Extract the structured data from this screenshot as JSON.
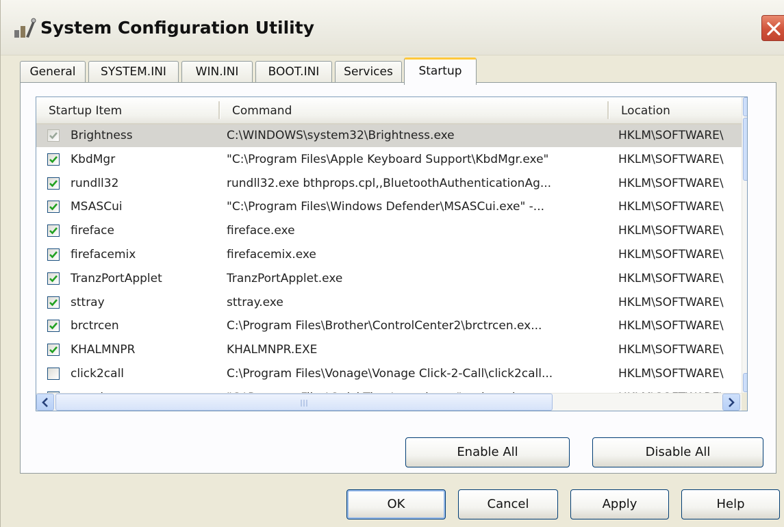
{
  "window": {
    "title": "System Configuration Utility"
  },
  "tabs": [
    {
      "label": "General"
    },
    {
      "label": "SYSTEM.INI"
    },
    {
      "label": "WIN.INI"
    },
    {
      "label": "BOOT.INI"
    },
    {
      "label": "Services"
    },
    {
      "label": "Startup"
    }
  ],
  "active_tab": "Startup",
  "list": {
    "columns": [
      "Startup Item",
      "Command",
      "Location"
    ],
    "rows": [
      {
        "item": "Brightness",
        "command": "C:\\WINDOWS\\system32\\Brightness.exe",
        "location": "HKLM\\SOFTWARE\\",
        "checked": true,
        "selected": true
      },
      {
        "item": "KbdMgr",
        "command": "\"C:\\Program Files\\Apple Keyboard Support\\KbdMgr.exe\"",
        "location": "HKLM\\SOFTWARE\\",
        "checked": true,
        "selected": false
      },
      {
        "item": "rundll32",
        "command": "rundll32.exe bthprops.cpl,,BluetoothAuthenticationAg...",
        "location": "HKLM\\SOFTWARE\\",
        "checked": true,
        "selected": false
      },
      {
        "item": "MSASCui",
        "command": "\"C:\\Program Files\\Windows Defender\\MSASCui.exe\" -...",
        "location": "HKLM\\SOFTWARE\\",
        "checked": true,
        "selected": false
      },
      {
        "item": "fireface",
        "command": "fireface.exe",
        "location": "HKLM\\SOFTWARE\\",
        "checked": true,
        "selected": false
      },
      {
        "item": "firefacemix",
        "command": "firefacemix.exe",
        "location": "HKLM\\SOFTWARE\\",
        "checked": true,
        "selected": false
      },
      {
        "item": "TranzPortApplet",
        "command": "TranzPortApplet.exe",
        "location": "HKLM\\SOFTWARE\\",
        "checked": true,
        "selected": false
      },
      {
        "item": "sttray",
        "command": "sttray.exe",
        "location": "HKLM\\SOFTWARE\\",
        "checked": true,
        "selected": false
      },
      {
        "item": "brctrcen",
        "command": "C:\\Program Files\\Brother\\ControlCenter2\\brctrcen.ex...",
        "location": "HKLM\\SOFTWARE\\",
        "checked": true,
        "selected": false
      },
      {
        "item": "KHALMNPR",
        "command": "KHALMNPR.EXE",
        "location": "HKLM\\SOFTWARE\\",
        "checked": true,
        "selected": false
      },
      {
        "item": "click2call",
        "command": "C:\\Program Files\\Vonage\\Vonage Click-2-Call\\click2call...",
        "location": "HKLM\\SOFTWARE\\",
        "checked": false,
        "selected": false
      },
      {
        "item": "qttask",
        "command": "\"C:\\Program Files\\QuickTime\\qttask.exe\" -atboottime",
        "location": "HKLM\\SOFTWARE\\",
        "checked": true,
        "selected": false
      }
    ]
  },
  "panel_buttons": {
    "enable_all": "Enable All",
    "disable_all": "Disable All"
  },
  "dialog_buttons": {
    "ok": "OK",
    "cancel": "Cancel",
    "apply": "Apply",
    "help": "Help"
  },
  "icons": {
    "app": "system-config-icon",
    "close": "close-icon",
    "scroll_up": "chevron-up-icon",
    "scroll_down": "chevron-down-icon",
    "scroll_left": "chevron-left-icon",
    "scroll_right": "chevron-right-icon"
  },
  "colors": {
    "accent": "#ffc83c",
    "close_button": "#d0533a",
    "selection": "#d6d5d0",
    "border": "#003c74"
  }
}
